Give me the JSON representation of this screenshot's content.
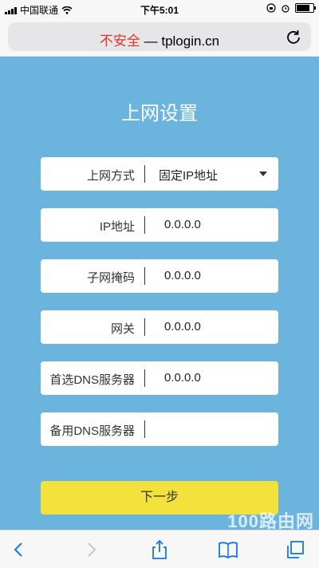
{
  "status_bar": {
    "carrier": "中国联通",
    "time": "下午5:01"
  },
  "browser": {
    "insecure_label": "不安全",
    "separator": "—",
    "domain": "tplogin.cn"
  },
  "page": {
    "title": "上网设置",
    "fields": [
      {
        "label": "上网方式",
        "value": "固定IP地址"
      },
      {
        "label": "IP地址",
        "value": "0.0.0.0"
      },
      {
        "label": "子网掩码",
        "value": "0.0.0.0"
      },
      {
        "label": "网关",
        "value": "0.0.0.0"
      },
      {
        "label": "首选DNS服务器",
        "value": "0.0.0.0"
      },
      {
        "label": "备用DNS服务器",
        "value": ""
      }
    ],
    "next_button": "下一步"
  },
  "watermark": "100路由网",
  "colors": {
    "background": "#6bb4dd",
    "button": "#f4e23c",
    "insecure": "#e6332a",
    "toolbar_icon": "#1a73e8"
  },
  "icons": {
    "signal": "signal-icon",
    "wifi": "wifi-icon",
    "orientation_lock": "orientation-lock-icon",
    "alarm": "alarm-icon",
    "battery": "battery-icon",
    "reload": "reload-icon",
    "back": "back-icon",
    "forward": "forward-icon",
    "share": "share-icon",
    "bookmarks": "bookmarks-icon",
    "tabs": "tabs-icon"
  }
}
